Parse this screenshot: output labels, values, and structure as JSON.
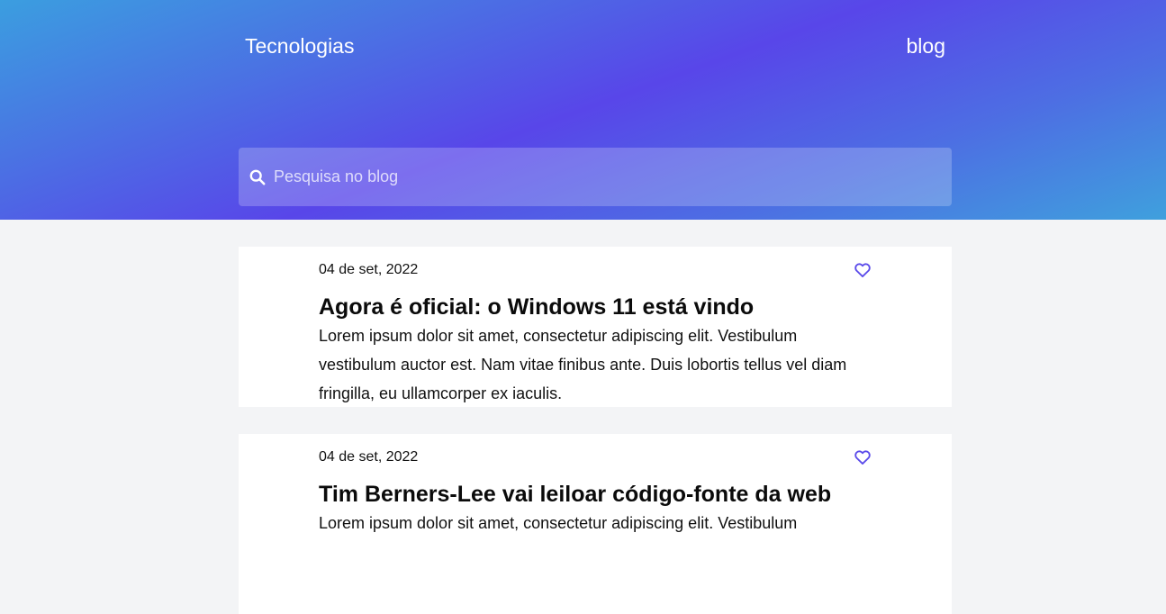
{
  "header": {
    "brand": "Tecnologias",
    "nav_blog": "blog"
  },
  "search": {
    "placeholder": "Pesquisa no blog",
    "icon": "search-icon"
  },
  "posts": [
    {
      "date": "04 de set, 2022",
      "title": "Agora é oficial: o Windows 11 está vindo",
      "excerpt": "Lorem ipsum dolor sit amet, consectetur adipiscing elit. Vestibulum vestibulum auctor est. Nam vitae finibus ante. Duis lobortis tellus vel diam fringilla, eu ullamcorper ex iaculis.",
      "like_icon": "heart-icon"
    },
    {
      "date": "04 de set, 2022",
      "title": "Tim Berners-Lee vai leiloar código-fonte da web",
      "excerpt": "Lorem ipsum dolor sit amet, consectetur adipiscing elit. Vestibulum",
      "like_icon": "heart-icon"
    }
  ],
  "colors": {
    "accent": "#5846e9",
    "heart": "#5b4bea",
    "background": "#f3f4f6"
  }
}
